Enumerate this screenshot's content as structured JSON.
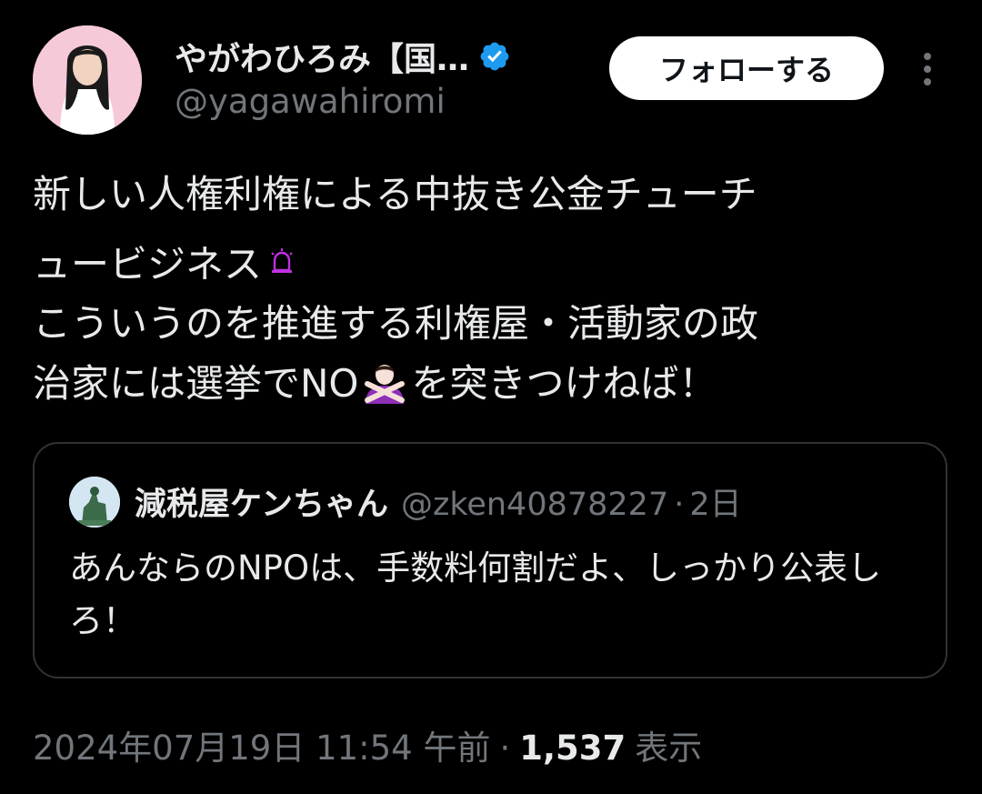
{
  "author": {
    "display_name": "やがわひろみ【国…",
    "handle": "@yagawahiromi",
    "verified": true
  },
  "follow_label": "フォローする",
  "tweet": {
    "line1": "新しい人権利権による中抜き公金チューチ",
    "line2": "ュービジネス",
    "line3": "こういうのを推進する利権屋・活動家の政",
    "line4_before": "治家には選挙でNO",
    "line4_after": "を突きつけねば！"
  },
  "quote": {
    "name": "減税屋ケンちゃん",
    "handle": "@zken40878227",
    "separator": "·",
    "time": "2日",
    "text": "あんならのNPOは、手数料何割だよ、しっかり公表しろ！"
  },
  "meta": {
    "timestamp": "2024年07月19日 11:54 午前",
    "separator": "·",
    "views_count": "1,537",
    "views_label": "表示"
  },
  "colors": {
    "background": "#000000",
    "text": "#e7e9ea",
    "muted": "#71767b",
    "verified_blue": "#1d9bf0",
    "border": "#2f3336"
  },
  "icons": {
    "verified": "verified-badge-icon",
    "more": "more-options-icon",
    "siren": "rotating-light-icon",
    "no_gesture": "person-gesturing-no-icon"
  }
}
